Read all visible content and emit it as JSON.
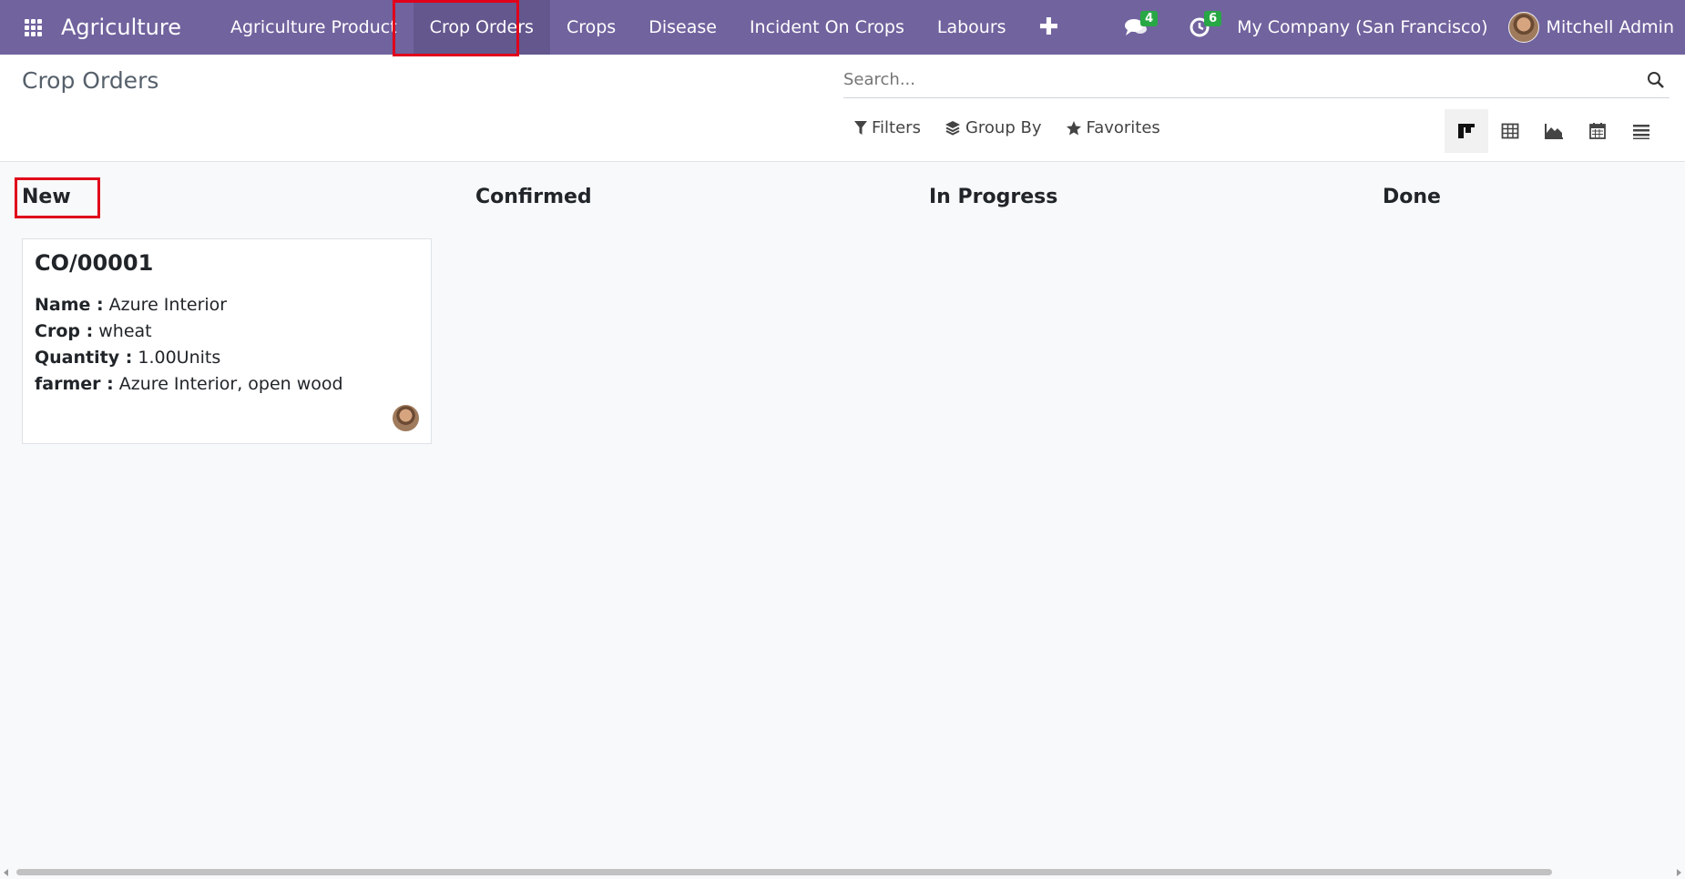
{
  "app": {
    "name": "Agriculture"
  },
  "menu": [
    {
      "label": "Agriculture Product",
      "active": false
    },
    {
      "label": "Crop Orders",
      "active": true
    },
    {
      "label": "Crops",
      "active": false
    },
    {
      "label": "Disease",
      "active": false
    },
    {
      "label": "Incident On Crops",
      "active": false
    },
    {
      "label": "Labours",
      "active": false
    }
  ],
  "systray": {
    "messages_count": "4",
    "activities_count": "6",
    "company": "My Company (San Francisco)",
    "user": "Mitchell Admin"
  },
  "page": {
    "title": "Crop Orders"
  },
  "search": {
    "placeholder": "Search..."
  },
  "filters": {
    "filters_label": "Filters",
    "groupby_label": "Group By",
    "favorites_label": "Favorites"
  },
  "views": [
    "kanban",
    "list",
    "graph",
    "calendar",
    "activity"
  ],
  "kanban": {
    "columns": [
      {
        "title": "New"
      },
      {
        "title": "Confirmed"
      },
      {
        "title": "In Progress"
      },
      {
        "title": "Done"
      }
    ],
    "card": {
      "ref": "CO/00001",
      "name_label": "Name :",
      "name_value": "Azure Interior",
      "crop_label": "Crop :",
      "crop_value": "wheat",
      "quantity_label": "Quantity :",
      "quantity_value": "1.00Units",
      "farmer_label": "farmer :",
      "farmer_value": "Azure Interior, open wood"
    }
  },
  "colors": {
    "navbar": "#71639e",
    "highlight": "#e0001b",
    "badge": "#28a745"
  }
}
